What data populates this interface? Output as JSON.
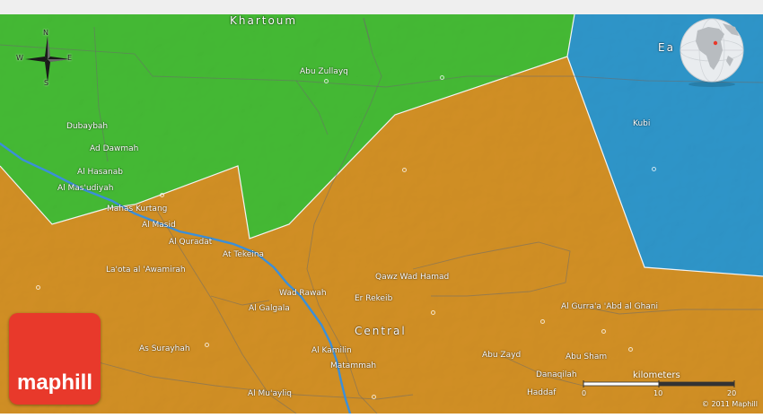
{
  "colors": {
    "orange": "#f1a52a",
    "green": "#4fd63c",
    "blue": "#35ace8",
    "river": "#3b8fd9",
    "brand_red": "#e8392b"
  },
  "regions": {
    "khartoum": "Khartoum",
    "central": "Central",
    "eastern_partial": "Ea"
  },
  "compass": {
    "n": "N",
    "s": "S",
    "e": "E",
    "w": "W"
  },
  "places": [
    "Abu Zullayq",
    "Dubaybah",
    "Ad Dawmah",
    "Al Hasanab",
    "Al Mas'udiyah",
    "Mahas Kurtang",
    "Al Masid",
    "Al Quradat",
    "At Tekeina",
    "La'ota al 'Awamirah",
    "Qawz Wad Hamad",
    "Wad Rawah",
    "Er Rekeib",
    "Al Galgala",
    "Al Gurra'a 'Abd al Ghani",
    "As Surayhah",
    "Al Kamilin",
    "Matammah",
    "Abu Zayd",
    "Abu Sham",
    "Danaqilah",
    "Haddaf",
    "Al Mu'ayliq",
    "Kubi"
  ],
  "scale": {
    "title": "kilometers",
    "ticks": [
      "0",
      "10",
      "20"
    ]
  },
  "copyright": "© 2011 Maphill",
  "brand": "maphill"
}
